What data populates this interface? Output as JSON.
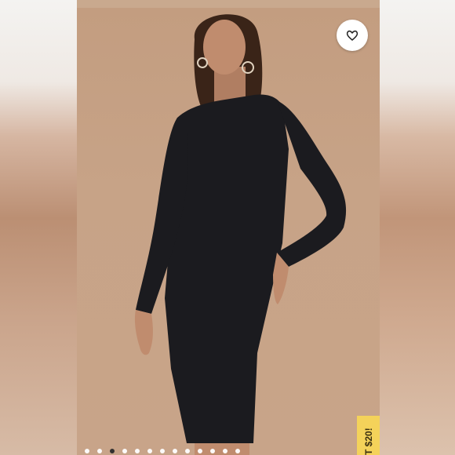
{
  "listing": {
    "photo_alt": "",
    "like_icon": "heart-icon",
    "carousel": {
      "total": 13,
      "active_index": 2
    },
    "promo_text": "T $20!"
  },
  "colors": {
    "background": "#c8a489",
    "dress": "#1b1b1f",
    "promo": "#f4d25a",
    "dot_active": "#2b2b2b"
  }
}
